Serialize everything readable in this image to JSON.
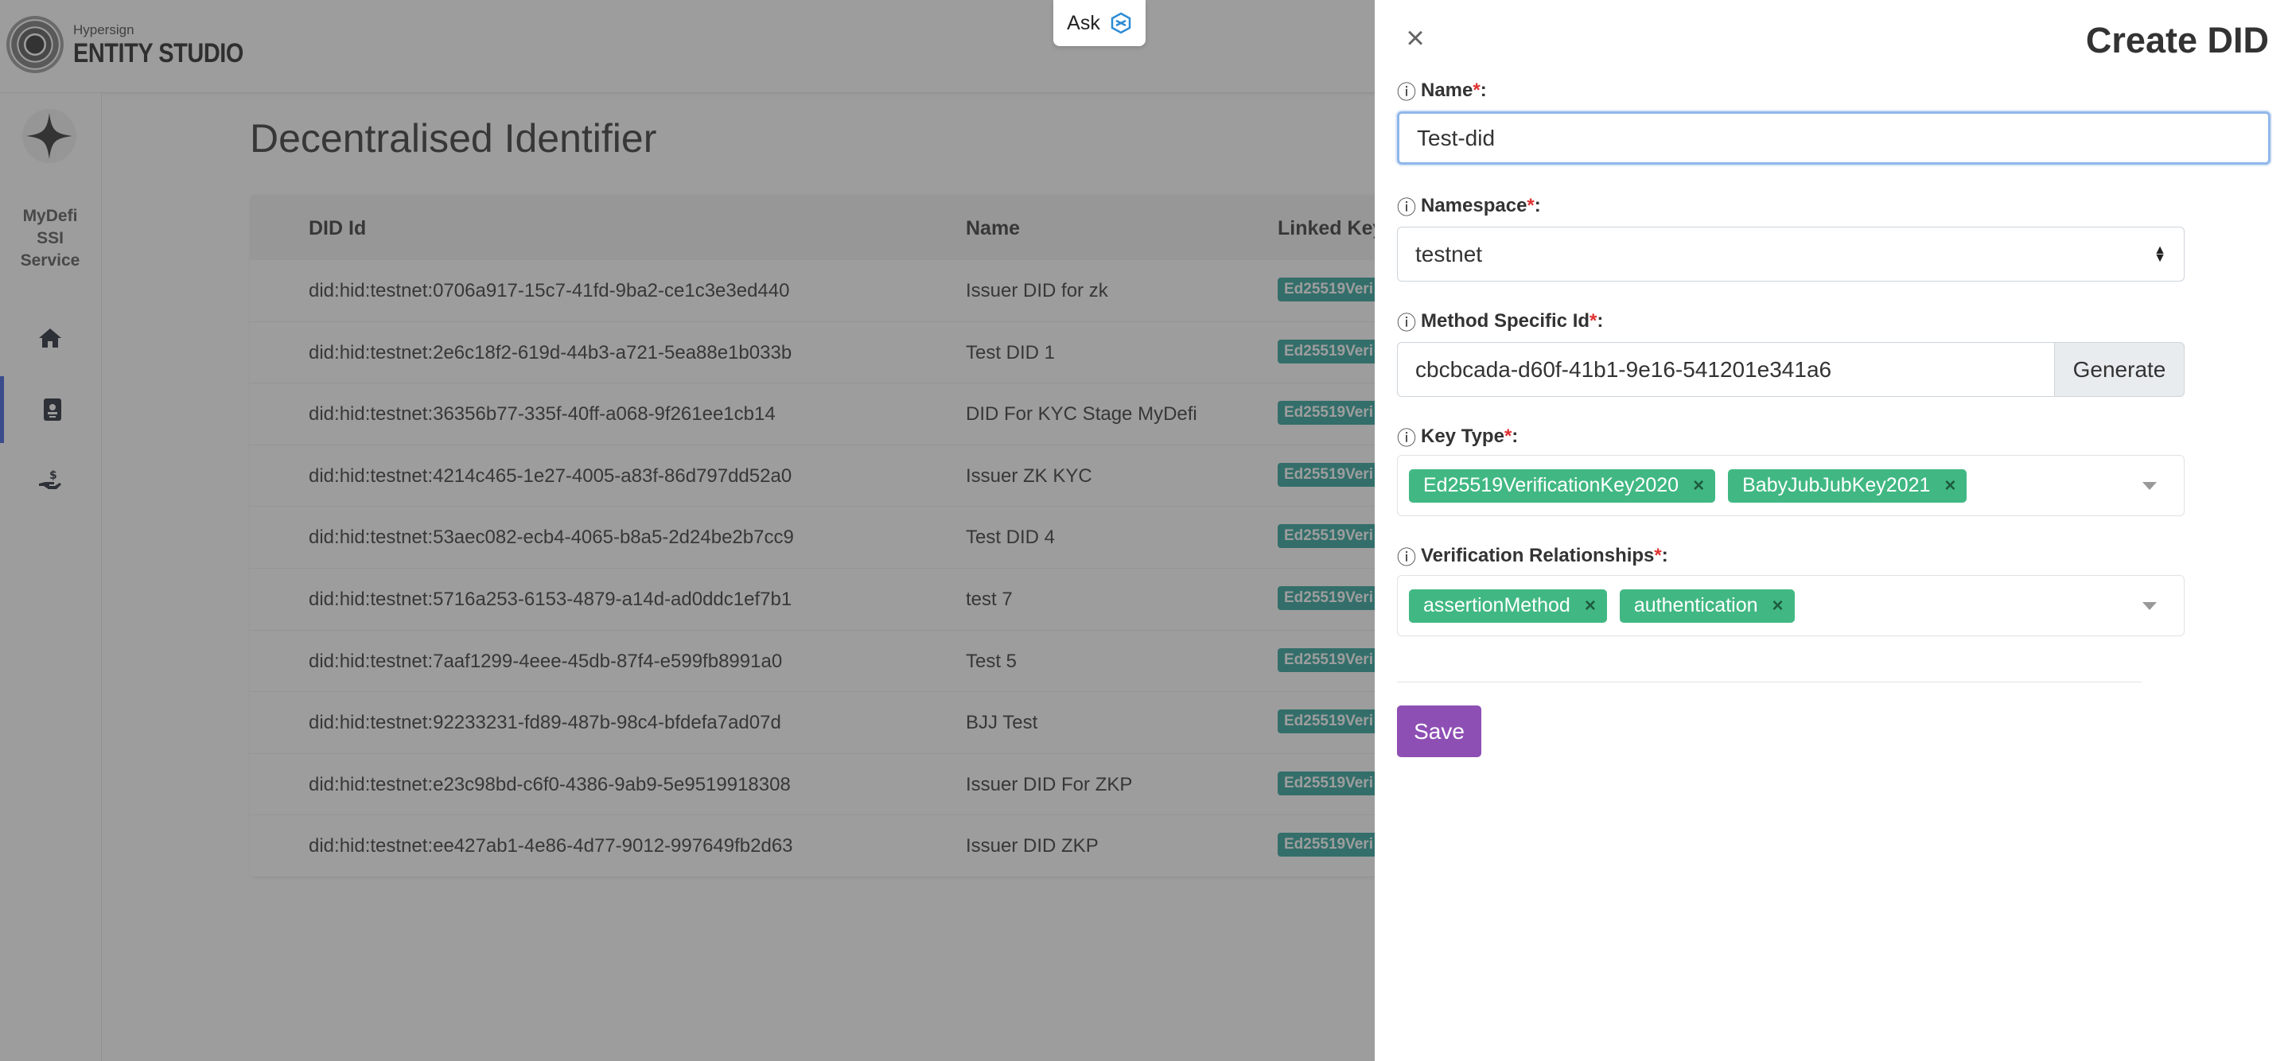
{
  "app": {
    "brand_small": "Hypersign",
    "brand_name": "ENTITY STUDIO",
    "ask_label": "Ask"
  },
  "sidebar": {
    "service_name_lines": [
      "MyDefi",
      "SSI",
      "Service"
    ],
    "items": [
      {
        "icon": "home-icon"
      },
      {
        "icon": "id-badge-icon",
        "active": true
      },
      {
        "icon": "hand-dollar-icon"
      }
    ]
  },
  "main": {
    "title": "Decentralised Identifier",
    "columns": [
      "DID Id",
      "Name",
      "Linked Key"
    ],
    "rows": [
      {
        "did": "did:hid:testnet:0706a917-15c7-41fd-9ba2-ce1c3e3ed440",
        "name": "Issuer DID for zk",
        "key": "Ed25519Veri"
      },
      {
        "did": "did:hid:testnet:2e6c18f2-619d-44b3-a721-5ea88e1b033b",
        "name": "Test DID 1",
        "key": "Ed25519Veri"
      },
      {
        "did": "did:hid:testnet:36356b77-335f-40ff-a068-9f261ee1cb14",
        "name": "DID For KYC Stage MyDefi",
        "key": "Ed25519Veri"
      },
      {
        "did": "did:hid:testnet:4214c465-1e27-4005-a83f-86d797dd52a0",
        "name": "Issuer ZK KYC",
        "key": "Ed25519Veri"
      },
      {
        "did": "did:hid:testnet:53aec082-ecb4-4065-b8a5-2d24be2b7cc9",
        "name": "Test DID 4",
        "key": "Ed25519Veri"
      },
      {
        "did": "did:hid:testnet:5716a253-6153-4879-a14d-ad0ddc1ef7b1",
        "name": "test 7",
        "key": "Ed25519Veri"
      },
      {
        "did": "did:hid:testnet:7aaf1299-4eee-45db-87f4-e599fb8991a0",
        "name": "Test 5",
        "key": "Ed25519Veri"
      },
      {
        "did": "did:hid:testnet:92233231-fd89-487b-98c4-bfdefa7ad07d",
        "name": "BJJ Test",
        "key": "Ed25519Veri"
      },
      {
        "did": "did:hid:testnet:e23c98bd-c6f0-4386-9ab9-5e9519918308",
        "name": "Issuer DID For ZKP",
        "key": "Ed25519Veri"
      },
      {
        "did": "did:hid:testnet:ee427ab1-4e86-4d77-9012-997649fb2d63",
        "name": "Issuer DID ZKP",
        "key": "Ed25519Veri"
      }
    ]
  },
  "panel": {
    "title": "Create DID",
    "info_glyph": "ⓘ",
    "required_mark": "*",
    "name": {
      "label": "Name",
      "value": "Test-did"
    },
    "namespace": {
      "label": "Namespace",
      "value": "testnet"
    },
    "method_specific_id": {
      "label": "Method Specific Id",
      "value": "cbcbcada-d60f-41b1-9e16-541201e341a6",
      "button": "Generate"
    },
    "key_type": {
      "label": "Key Type",
      "tags": [
        "Ed25519VerificationKey2020",
        "BabyJubJubKey2021"
      ]
    },
    "verification_relationships": {
      "label": "Verification Relationships",
      "tags": [
        "assertionMethod",
        "authentication"
      ]
    },
    "save_label": "Save"
  },
  "colors": {
    "accent_purple": "#8e4fb4",
    "tag_green": "#41b883",
    "active_sidebar": "#3b5bdb"
  }
}
